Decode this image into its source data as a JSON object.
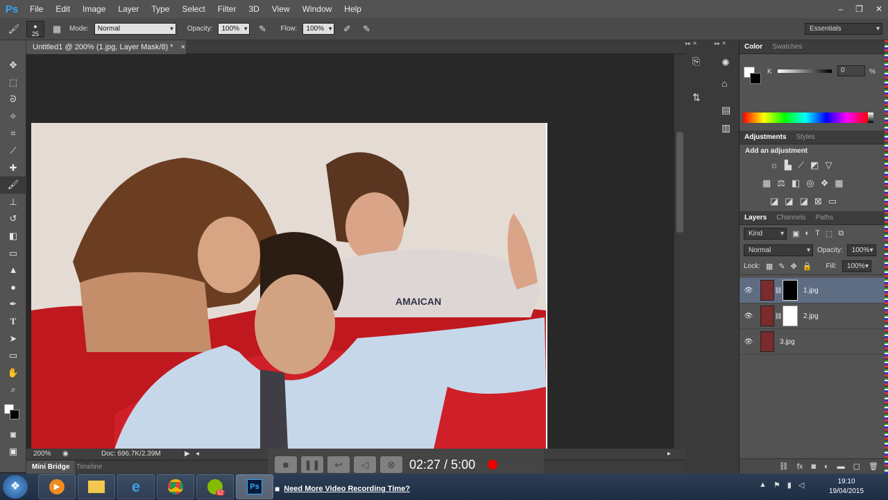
{
  "app": {
    "logo": "Ps"
  },
  "menu": [
    "File",
    "Edit",
    "Image",
    "Layer",
    "Type",
    "Select",
    "Filter",
    "3D",
    "View",
    "Window",
    "Help"
  ],
  "window_controls": [
    "–",
    "❐",
    "✕"
  ],
  "options": {
    "brush_size": "25",
    "mode_label": "Mode:",
    "mode_value": "Normal",
    "opacity_label": "Opacity:",
    "opacity_value": "100%",
    "flow_label": "Flow:",
    "flow_value": "100%",
    "workspace": "Essentials"
  },
  "document": {
    "tab_title": "Untitled1 @ 200% (1.jpg, Layer Mask/8) *",
    "close": "×",
    "zoom": "200%",
    "doc_info": "Doc: 696.7K/2.39M"
  },
  "photo": {
    "shirt_text": "AMAICAN"
  },
  "bottom_tabs": {
    "mini_bridge": "Mini Bridge",
    "timeline": "Timeline"
  },
  "color_panel": {
    "tabs": [
      "Color",
      "Swatches"
    ],
    "channel": "K",
    "value": "0",
    "unit": "%"
  },
  "adjustments_panel": {
    "tabs": [
      "Adjustments",
      "Styles"
    ],
    "heading": "Add an adjustment"
  },
  "layers_panel": {
    "tabs": [
      "Layers",
      "Channels",
      "Paths"
    ],
    "filter": "Kind",
    "blend_mode": "Normal",
    "opacity_label": "Opacity:",
    "opacity_value": "100%",
    "lock_label": "Lock:",
    "fill_label": "Fill:",
    "fill_value": "100%",
    "layers": [
      {
        "name": "1.jpg",
        "selected": true,
        "mask": "black"
      },
      {
        "name": "2.jpg",
        "selected": false,
        "mask": "white"
      },
      {
        "name": "3.jpg",
        "selected": false,
        "mask": "none"
      }
    ]
  },
  "video_overlay": {
    "time": "02:27 / 5:00",
    "promo": "Need More Video Recording Time?"
  },
  "taskbar": {
    "spotify_badge": "52",
    "clock_time": "19:10",
    "clock_date": "19/04/2015"
  }
}
